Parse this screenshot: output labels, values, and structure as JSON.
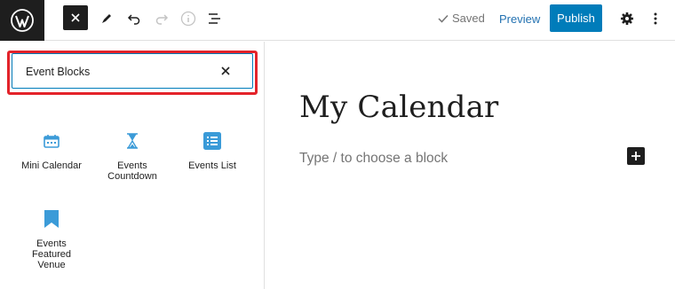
{
  "toolbar": {
    "logo_icon": "wordpress-logo-icon",
    "close_icon": "close-icon",
    "tools_icon": "pencil-icon",
    "undo_icon": "undo-icon",
    "redo_icon": "redo-icon",
    "details_icon": "info-icon",
    "outline_icon": "list-view-icon",
    "saved_label": "Saved",
    "preview_label": "Preview",
    "publish_label": "Publish",
    "settings_icon": "gear-icon",
    "options_icon": "more-vertical-icon"
  },
  "inserter": {
    "search_value": "Event Blocks",
    "clear_icon": "close-icon",
    "blocks": [
      {
        "label": "Mini Calendar",
        "icon": "calendar-icon"
      },
      {
        "label": "Events Countdown",
        "icon": "hourglass-icon"
      },
      {
        "label": "Events List",
        "icon": "list-icon"
      },
      {
        "label": "Events Featured Venue",
        "icon": "bookmark-icon"
      }
    ]
  },
  "editor": {
    "title": "My Calendar",
    "placeholder": "Type / to choose a block",
    "add_icon": "plus-icon"
  },
  "colors": {
    "accent": "#007cba",
    "highlight": "#e3232a",
    "dark": "#1e1e1e",
    "block_icon": "#3b9bd8"
  }
}
